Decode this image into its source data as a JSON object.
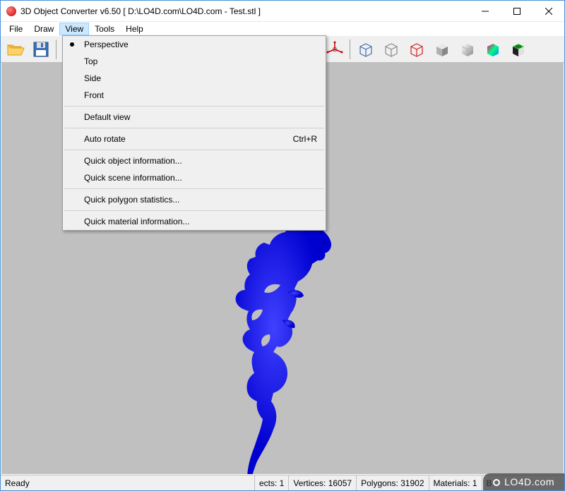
{
  "window": {
    "title": "3D Object Converter v6.50     [ D:\\LO4D.com\\LO4D.com - Test.stl ]"
  },
  "menu": {
    "items": [
      "File",
      "Draw",
      "View",
      "Tools",
      "Help"
    ],
    "active_index": 2
  },
  "dropdown": {
    "groups": [
      [
        {
          "label": "Perspective",
          "selected": true,
          "shortcut": ""
        },
        {
          "label": "Top",
          "selected": false,
          "shortcut": ""
        },
        {
          "label": "Side",
          "selected": false,
          "shortcut": ""
        },
        {
          "label": "Front",
          "selected": false,
          "shortcut": ""
        }
      ],
      [
        {
          "label": "Default view",
          "selected": false,
          "shortcut": ""
        }
      ],
      [
        {
          "label": "Auto rotate",
          "selected": false,
          "shortcut": "Ctrl+R"
        }
      ],
      [
        {
          "label": "Quick object information...",
          "selected": false,
          "shortcut": ""
        },
        {
          "label": "Quick scene information...",
          "selected": false,
          "shortcut": ""
        }
      ],
      [
        {
          "label": "Quick polygon statistics...",
          "selected": false,
          "shortcut": ""
        }
      ],
      [
        {
          "label": "Quick material information...",
          "selected": false,
          "shortcut": ""
        }
      ]
    ]
  },
  "status": {
    "ready": "Ready",
    "objects": "ects: 1",
    "vertices": "Vertices: 16057",
    "polygons": "Polygons: 31902",
    "materials": "Materials: 1",
    "extra": "B"
  },
  "watermark": "LO4D.com",
  "colors": {
    "viewport_bg": "#c0c0c0",
    "model": "#1a1aff",
    "accent": "#cce8ff"
  }
}
